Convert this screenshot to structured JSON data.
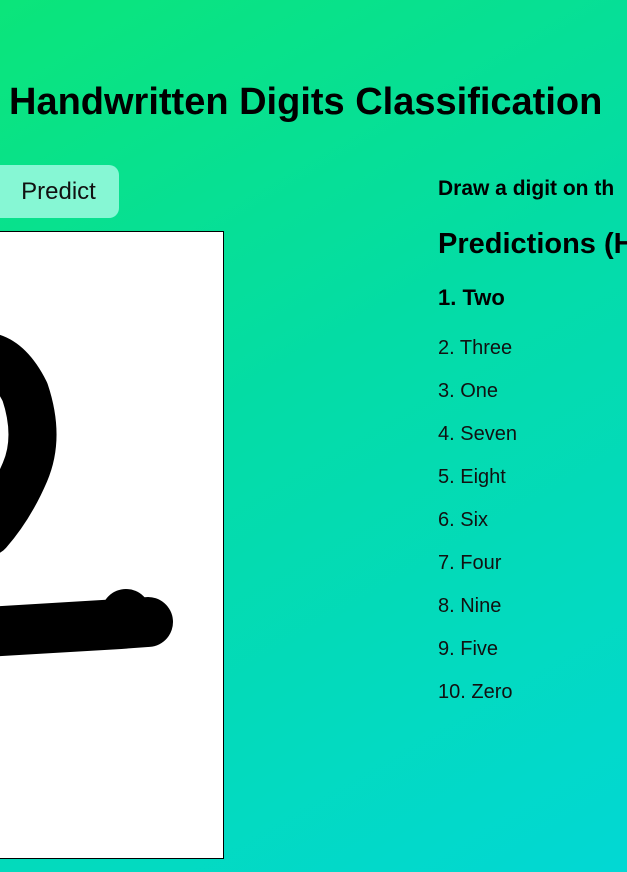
{
  "header": {
    "title": "Handwritten Digits Classification"
  },
  "toolbar": {
    "predict_label": "Predict"
  },
  "sidebar": {
    "instruction": "Draw a digit on th",
    "predictions_heading": "Predictions (H"
  },
  "predictions": [
    "1. Two",
    "2. Three",
    "3. One",
    "4. Seven",
    "5. Eight",
    "6. Six",
    "7. Four",
    "8. Nine",
    "9. Five",
    "10. Zero"
  ],
  "colors": {
    "gradient_start": "#0be57a",
    "gradient_end": "#02d8d4",
    "button_bg": "#86f7d4",
    "canvas_bg": "#ffffff",
    "ink": "#000000"
  }
}
